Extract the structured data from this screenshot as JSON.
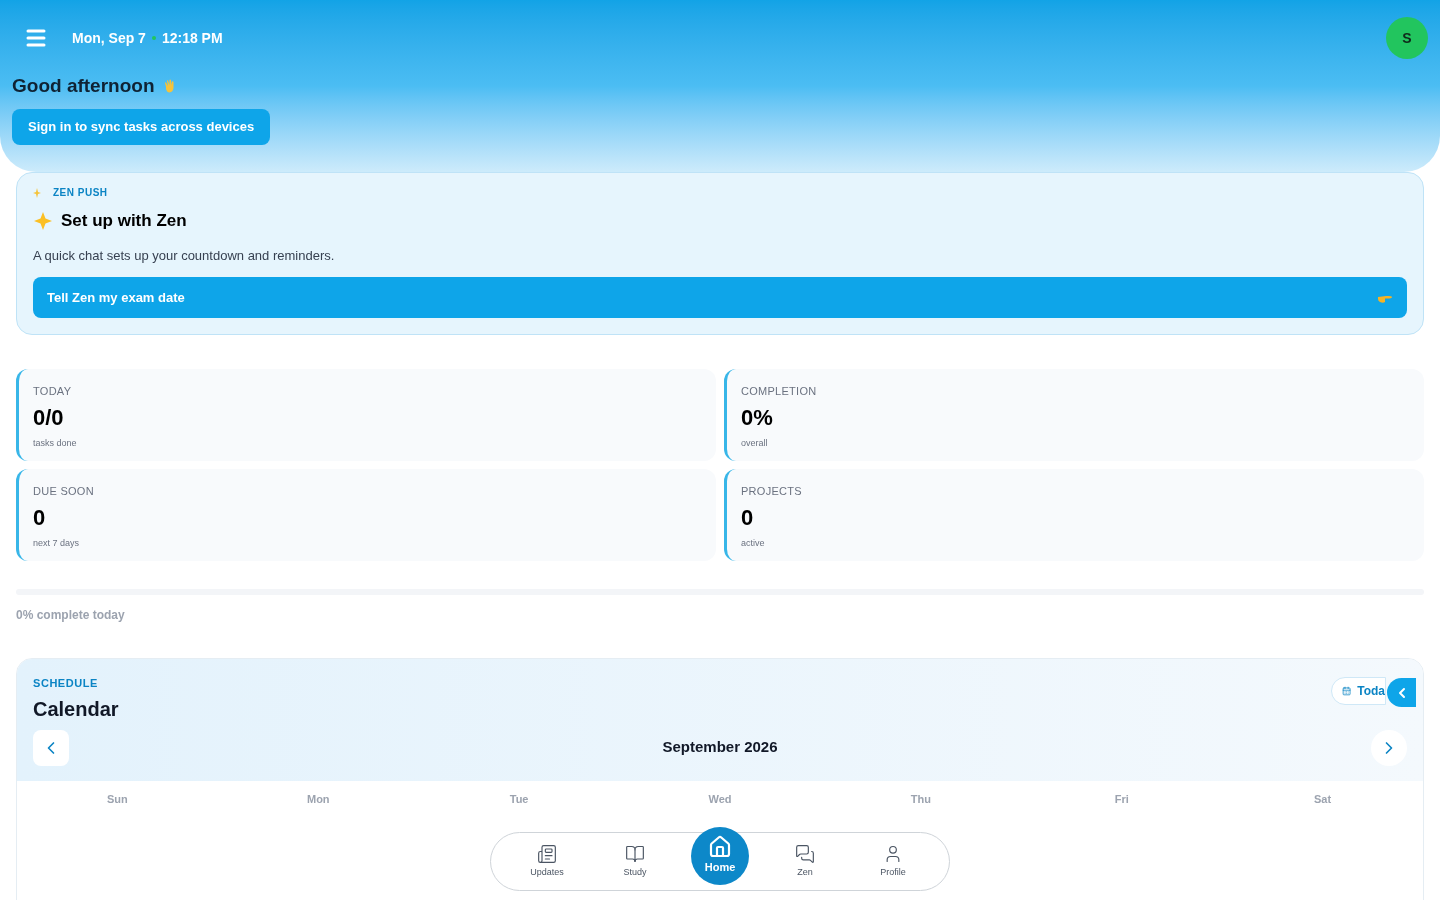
{
  "header": {
    "date": "Mon, Sep 7",
    "time": "12:18 PM",
    "avatar": "S",
    "greeting": "Good afternoon",
    "sign_in_button": "Sign in to sync tasks across devices"
  },
  "zen_card": {
    "eyebrow": "ZEN PUSH",
    "title": "Set up with Zen",
    "description": "A quick chat sets up your countdown and reminders.",
    "button": "Tell Zen my exam date"
  },
  "stats": [
    {
      "label": "TODAY",
      "value": "0/0",
      "caption": "tasks done"
    },
    {
      "label": "COMPLETION",
      "value": "0%",
      "caption": "overall"
    },
    {
      "label": "DUE SOON",
      "value": "0",
      "caption": "next 7 days"
    },
    {
      "label": "PROJECTS",
      "value": "0",
      "caption": "active"
    }
  ],
  "progress": {
    "level": 0,
    "caption": "0% complete today"
  },
  "calendar": {
    "eyebrow": "SCHEDULE",
    "title": "Calendar",
    "today_button": "Toda",
    "month": "September 2026",
    "weekdays": [
      "Sun",
      "Mon",
      "Tue",
      "Wed",
      "Thu",
      "Fri",
      "Sat"
    ]
  },
  "bottom_nav": [
    {
      "kind": "updates",
      "label": "Updates",
      "selected": false
    },
    {
      "kind": "study",
      "label": "Study",
      "selected": false
    },
    {
      "kind": "home",
      "label": "Home",
      "selected": true
    },
    {
      "kind": "zen",
      "label": "Zen",
      "selected": false
    },
    {
      "kind": "profile",
      "label": "Profile",
      "selected": false
    }
  ]
}
